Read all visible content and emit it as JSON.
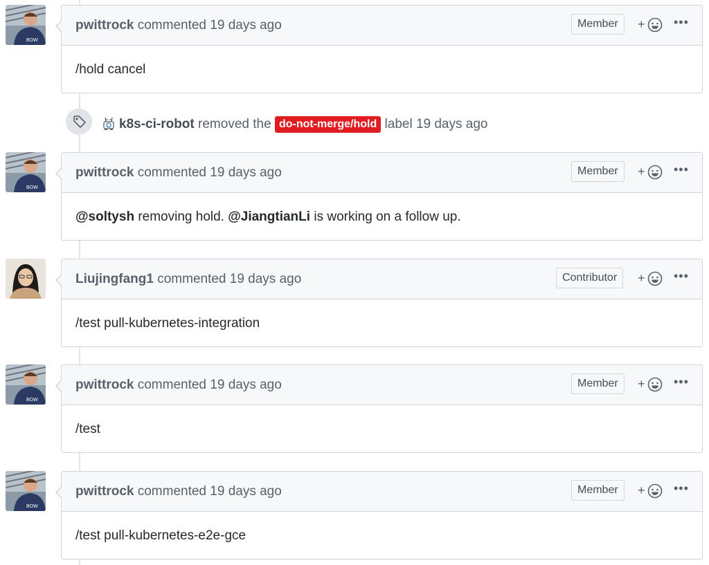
{
  "comments": [
    {
      "author": "pwittrock",
      "action": "commented 19 days ago",
      "role": "Member",
      "body_text": "/hold cancel"
    },
    {
      "author": "pwittrock",
      "action": "commented 19 days ago",
      "role": "Member",
      "body_mention1": "@soltysh",
      "body_mid": " removing hold. ",
      "body_mention2": "@JiangtianLi",
      "body_end": " is working on a follow up."
    },
    {
      "author": "Liujingfang1",
      "action": "commented 19 days ago",
      "role": "Contributor",
      "body_text": "/test pull-kubernetes-integration"
    },
    {
      "author": "pwittrock",
      "action": "commented 19 days ago",
      "role": "Member",
      "body_text": "/test"
    },
    {
      "author": "pwittrock",
      "action": "commented 19 days ago",
      "role": "Member",
      "body_text": "/test pull-kubernetes-e2e-gce"
    }
  ],
  "event": {
    "actor": "k8s-ci-robot",
    "action": "removed the",
    "label": "do-not-merge/hold",
    "label_color": "#e11d21",
    "suffix": "label 19 days ago"
  },
  "reaction_plus": "+",
  "more_dots": "•••"
}
